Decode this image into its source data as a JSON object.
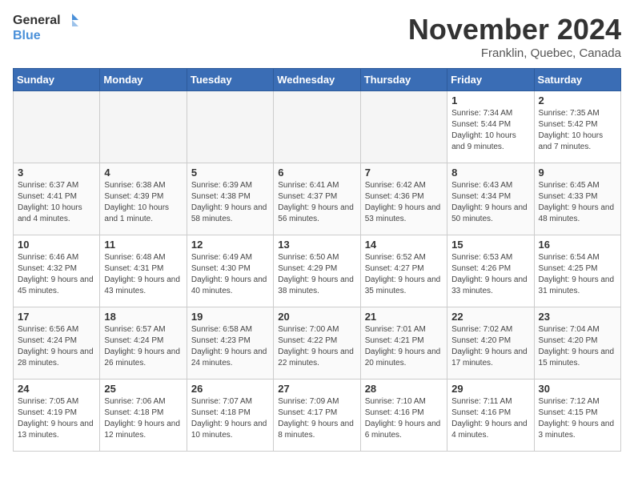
{
  "logo": {
    "line1": "General",
    "line2": "Blue"
  },
  "title": "November 2024",
  "subtitle": "Franklin, Quebec, Canada",
  "weekdays": [
    "Sunday",
    "Monday",
    "Tuesday",
    "Wednesday",
    "Thursday",
    "Friday",
    "Saturday"
  ],
  "weeks": [
    [
      {
        "day": "",
        "info": ""
      },
      {
        "day": "",
        "info": ""
      },
      {
        "day": "",
        "info": ""
      },
      {
        "day": "",
        "info": ""
      },
      {
        "day": "",
        "info": ""
      },
      {
        "day": "1",
        "info": "Sunrise: 7:34 AM\nSunset: 5:44 PM\nDaylight: 10 hours and 9 minutes."
      },
      {
        "day": "2",
        "info": "Sunrise: 7:35 AM\nSunset: 5:42 PM\nDaylight: 10 hours and 7 minutes."
      }
    ],
    [
      {
        "day": "3",
        "info": "Sunrise: 6:37 AM\nSunset: 4:41 PM\nDaylight: 10 hours and 4 minutes."
      },
      {
        "day": "4",
        "info": "Sunrise: 6:38 AM\nSunset: 4:39 PM\nDaylight: 10 hours and 1 minute."
      },
      {
        "day": "5",
        "info": "Sunrise: 6:39 AM\nSunset: 4:38 PM\nDaylight: 9 hours and 58 minutes."
      },
      {
        "day": "6",
        "info": "Sunrise: 6:41 AM\nSunset: 4:37 PM\nDaylight: 9 hours and 56 minutes."
      },
      {
        "day": "7",
        "info": "Sunrise: 6:42 AM\nSunset: 4:36 PM\nDaylight: 9 hours and 53 minutes."
      },
      {
        "day": "8",
        "info": "Sunrise: 6:43 AM\nSunset: 4:34 PM\nDaylight: 9 hours and 50 minutes."
      },
      {
        "day": "9",
        "info": "Sunrise: 6:45 AM\nSunset: 4:33 PM\nDaylight: 9 hours and 48 minutes."
      }
    ],
    [
      {
        "day": "10",
        "info": "Sunrise: 6:46 AM\nSunset: 4:32 PM\nDaylight: 9 hours and 45 minutes."
      },
      {
        "day": "11",
        "info": "Sunrise: 6:48 AM\nSunset: 4:31 PM\nDaylight: 9 hours and 43 minutes."
      },
      {
        "day": "12",
        "info": "Sunrise: 6:49 AM\nSunset: 4:30 PM\nDaylight: 9 hours and 40 minutes."
      },
      {
        "day": "13",
        "info": "Sunrise: 6:50 AM\nSunset: 4:29 PM\nDaylight: 9 hours and 38 minutes."
      },
      {
        "day": "14",
        "info": "Sunrise: 6:52 AM\nSunset: 4:27 PM\nDaylight: 9 hours and 35 minutes."
      },
      {
        "day": "15",
        "info": "Sunrise: 6:53 AM\nSunset: 4:26 PM\nDaylight: 9 hours and 33 minutes."
      },
      {
        "day": "16",
        "info": "Sunrise: 6:54 AM\nSunset: 4:25 PM\nDaylight: 9 hours and 31 minutes."
      }
    ],
    [
      {
        "day": "17",
        "info": "Sunrise: 6:56 AM\nSunset: 4:24 PM\nDaylight: 9 hours and 28 minutes."
      },
      {
        "day": "18",
        "info": "Sunrise: 6:57 AM\nSunset: 4:24 PM\nDaylight: 9 hours and 26 minutes."
      },
      {
        "day": "19",
        "info": "Sunrise: 6:58 AM\nSunset: 4:23 PM\nDaylight: 9 hours and 24 minutes."
      },
      {
        "day": "20",
        "info": "Sunrise: 7:00 AM\nSunset: 4:22 PM\nDaylight: 9 hours and 22 minutes."
      },
      {
        "day": "21",
        "info": "Sunrise: 7:01 AM\nSunset: 4:21 PM\nDaylight: 9 hours and 20 minutes."
      },
      {
        "day": "22",
        "info": "Sunrise: 7:02 AM\nSunset: 4:20 PM\nDaylight: 9 hours and 17 minutes."
      },
      {
        "day": "23",
        "info": "Sunrise: 7:04 AM\nSunset: 4:20 PM\nDaylight: 9 hours and 15 minutes."
      }
    ],
    [
      {
        "day": "24",
        "info": "Sunrise: 7:05 AM\nSunset: 4:19 PM\nDaylight: 9 hours and 13 minutes."
      },
      {
        "day": "25",
        "info": "Sunrise: 7:06 AM\nSunset: 4:18 PM\nDaylight: 9 hours and 12 minutes."
      },
      {
        "day": "26",
        "info": "Sunrise: 7:07 AM\nSunset: 4:18 PM\nDaylight: 9 hours and 10 minutes."
      },
      {
        "day": "27",
        "info": "Sunrise: 7:09 AM\nSunset: 4:17 PM\nDaylight: 9 hours and 8 minutes."
      },
      {
        "day": "28",
        "info": "Sunrise: 7:10 AM\nSunset: 4:16 PM\nDaylight: 9 hours and 6 minutes."
      },
      {
        "day": "29",
        "info": "Sunrise: 7:11 AM\nSunset: 4:16 PM\nDaylight: 9 hours and 4 minutes."
      },
      {
        "day": "30",
        "info": "Sunrise: 7:12 AM\nSunset: 4:15 PM\nDaylight: 9 hours and 3 minutes."
      }
    ]
  ]
}
